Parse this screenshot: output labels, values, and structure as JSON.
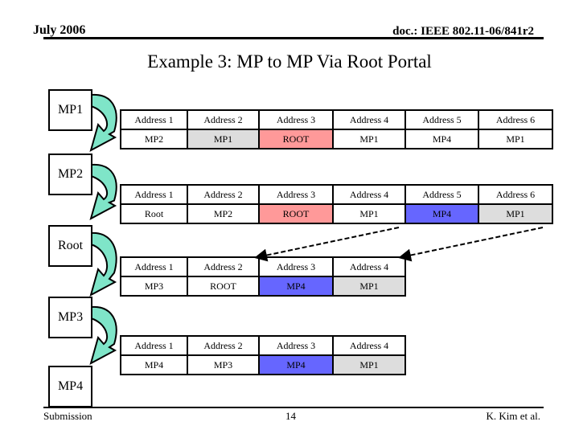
{
  "header": {
    "date": "July 2006",
    "doc": "doc.: IEEE 802.11-06/841r2"
  },
  "title": "Example 3: MP to MP Via Root Portal",
  "nodes": [
    "MP1",
    "MP2",
    "Root",
    "MP3",
    "MP4"
  ],
  "colors": {
    "pink": "#ff9999",
    "blue": "#6666ff",
    "gray": "#dddddd",
    "arrow": "#7fe5c8"
  },
  "tables": [
    {
      "headers": [
        "Address 1",
        "Address 2",
        "Address 3",
        "Address 4",
        "Address 5",
        "Address 6"
      ],
      "values": [
        "MP2",
        "MP1",
        "ROOT",
        "MP1",
        "MP4",
        "MP1"
      ],
      "highlights": [
        "",
        "gray",
        "pink",
        "",
        "",
        ""
      ]
    },
    {
      "headers": [
        "Address 1",
        "Address 2",
        "Address 3",
        "Address 4",
        "Address 5",
        "Address 6"
      ],
      "values": [
        "Root",
        "MP2",
        "ROOT",
        "MP1",
        "MP4",
        "MP1"
      ],
      "highlights": [
        "",
        "",
        "pink",
        "",
        "blue",
        "gray"
      ]
    },
    {
      "headers": [
        "Address 1",
        "Address 2",
        "Address 3",
        "Address 4"
      ],
      "values": [
        "MP3",
        "ROOT",
        "MP4",
        "MP1"
      ],
      "highlights": [
        "",
        "",
        "blue",
        "gray"
      ]
    },
    {
      "headers": [
        "Address 1",
        "Address 2",
        "Address 3",
        "Address 4"
      ],
      "values": [
        "MP4",
        "MP3",
        "MP4",
        "MP1"
      ],
      "highlights": [
        "",
        "",
        "blue",
        "gray"
      ]
    }
  ],
  "footer": {
    "left": "Submission",
    "page": "14",
    "right": "K. Kim et al."
  }
}
